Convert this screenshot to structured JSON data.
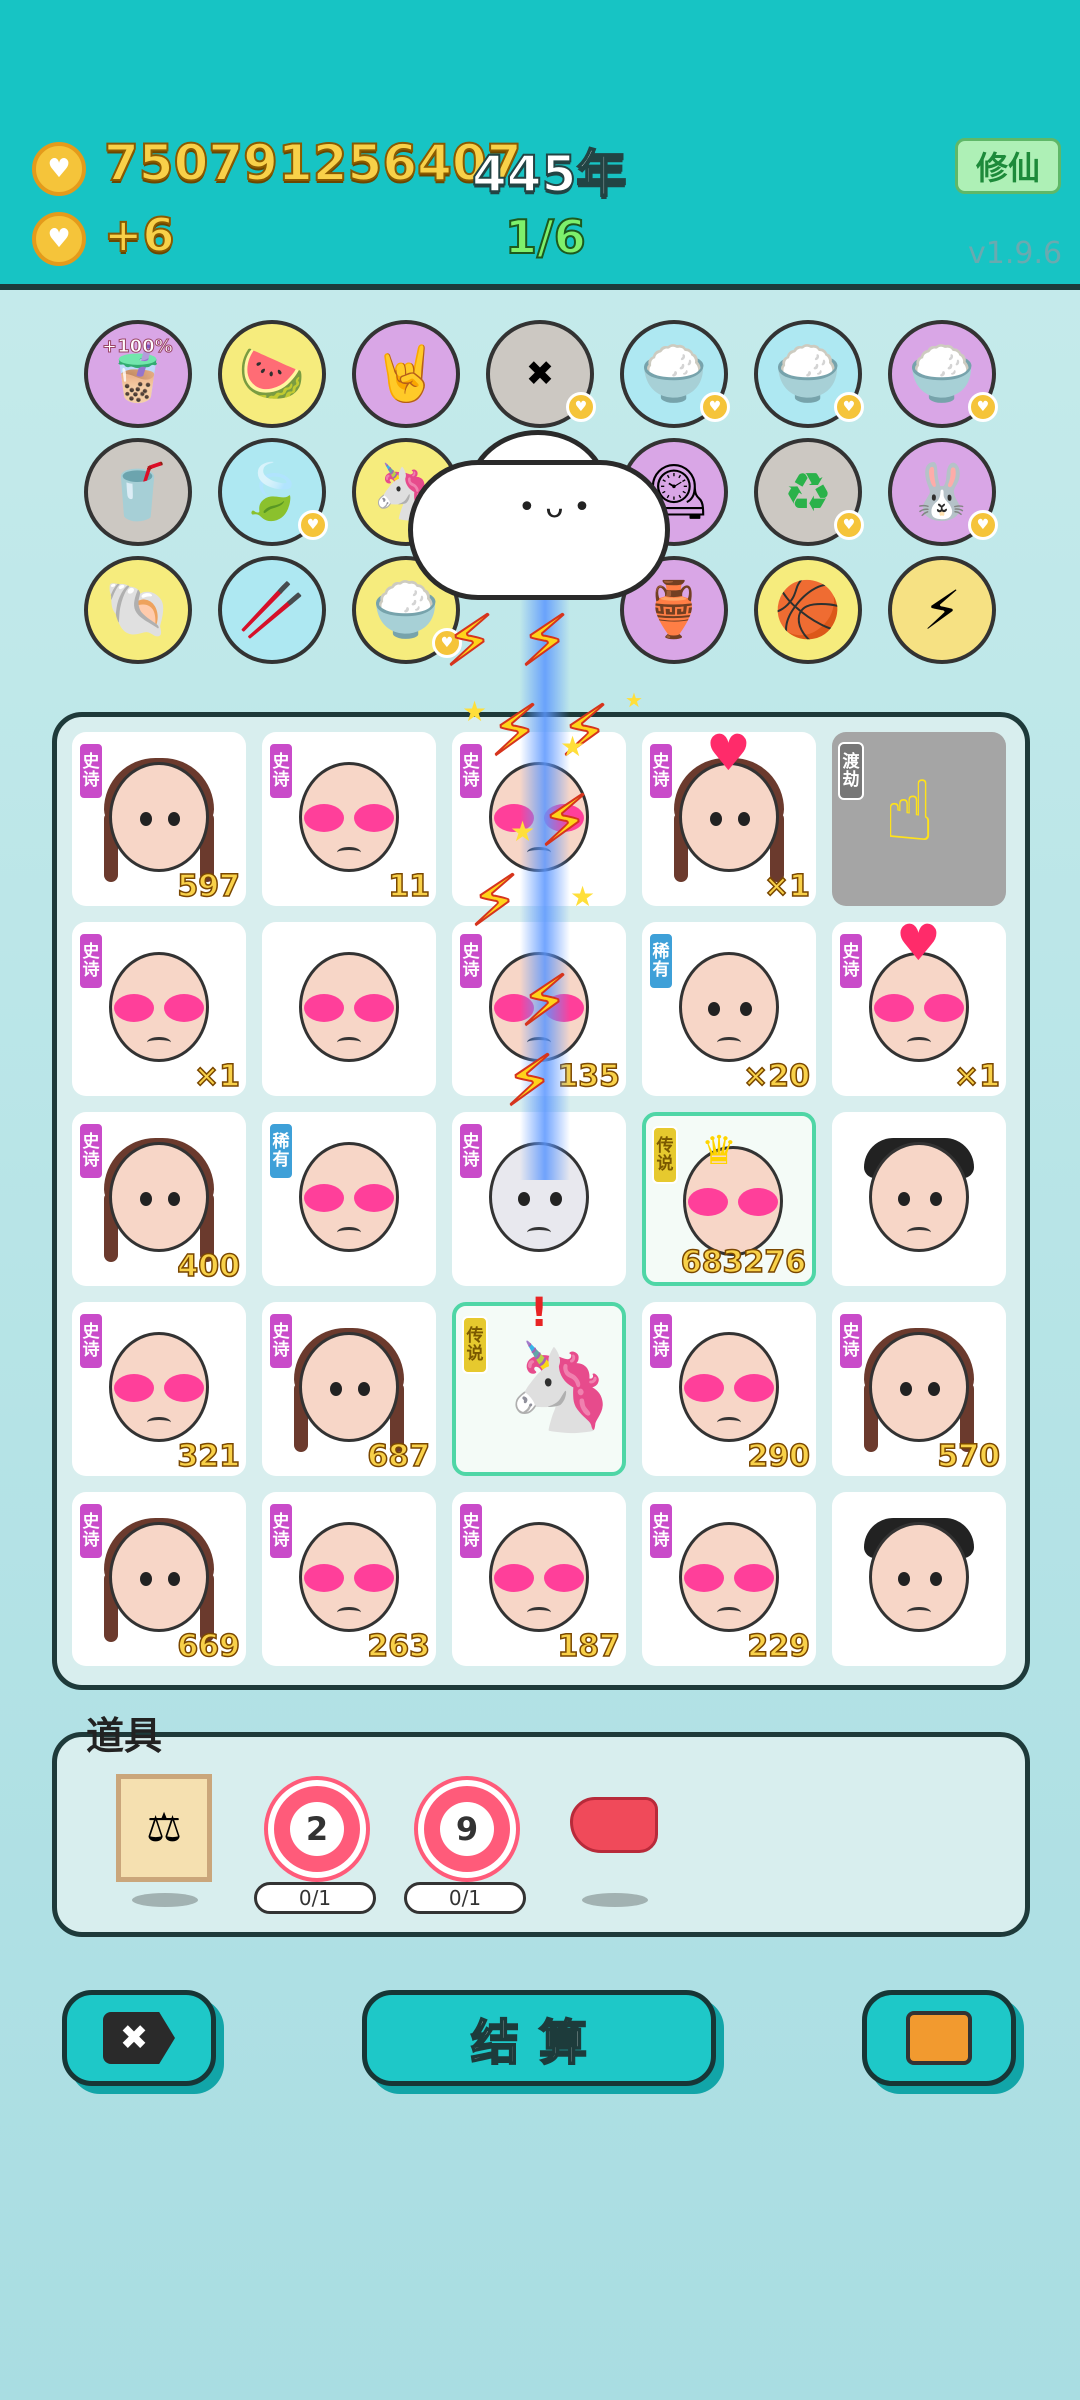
{
  "header": {
    "coins": "750791256407",
    "years": "445年",
    "income": "+6",
    "progress": "1/6",
    "xiuxian_label": "修仙",
    "version": "v1.9.6"
  },
  "items": {
    "row1": [
      {
        "icon": "milk-tea-icon",
        "glyph": "🧋",
        "tag": "+100%"
      },
      {
        "icon": "fruit-basket-icon",
        "glyph": "🍉",
        "tag": ""
      },
      {
        "icon": "rock-hand-icon",
        "glyph": "🤘",
        "tag": ""
      },
      {
        "icon": "delete-tag-icon",
        "glyph": "✖",
        "tag": ""
      },
      {
        "icon": "rice-bowl-icon",
        "glyph": "🍚",
        "tag": ""
      },
      {
        "icon": "rice-bowl-icon",
        "glyph": "🍚",
        "tag": ""
      },
      {
        "icon": "rice-bowl-icon",
        "glyph": "🍚",
        "tag": ""
      }
    ],
    "row2": [
      {
        "icon": "milk-tea-icon",
        "glyph": "🥤"
      },
      {
        "icon": "leaf-icon",
        "glyph": "🍃"
      },
      {
        "icon": "unicorn-icon",
        "glyph": "🦄"
      },
      {
        "icon": "time-portrait-icon",
        "glyph": "🕰"
      },
      {
        "icon": "refresh-icon",
        "glyph": "♻"
      },
      {
        "icon": "rabbit-icon",
        "glyph": "🐰"
      }
    ],
    "row3": [
      {
        "icon": "shell-icon",
        "glyph": "🐚"
      },
      {
        "icon": "chopsticks-icon",
        "glyph": "🥢"
      },
      {
        "icon": "rice-bowl-icon",
        "glyph": "🍚"
      },
      {
        "icon": "jar-icon",
        "glyph": "🏺"
      },
      {
        "icon": "basketballs-icon",
        "glyph": "🏀"
      },
      {
        "icon": "lightning-icon",
        "glyph": "⚡"
      }
    ]
  },
  "board": {
    "cells": [
      {
        "badge": "史诗",
        "kind": "epic",
        "face": "girl",
        "value": "597"
      },
      {
        "badge": "史诗",
        "kind": "epic",
        "face": "bald-heart",
        "value": "11"
      },
      {
        "badge": "史诗",
        "kind": "epic",
        "face": "bald-heart",
        "value": ""
      },
      {
        "badge": "史诗",
        "kind": "epic",
        "face": "girl",
        "value": "×1"
      },
      {
        "badge": "渡劫",
        "kind": "dujie",
        "face": "pointer",
        "value": ""
      },
      {
        "badge": "史诗",
        "kind": "epic",
        "face": "bald-heart",
        "value": "×1"
      },
      {
        "badge": "",
        "kind": "",
        "face": "old-heart",
        "value": ""
      },
      {
        "badge": "史诗",
        "kind": "epic",
        "face": "bald-heart",
        "value": "135"
      },
      {
        "badge": "稀有",
        "kind": "rare",
        "face": "bald-eyes",
        "value": "×20"
      },
      {
        "badge": "史诗",
        "kind": "epic",
        "face": "bald-heart",
        "value": "×1"
      },
      {
        "badge": "史诗",
        "kind": "epic",
        "face": "girl",
        "value": "400"
      },
      {
        "badge": "稀有",
        "kind": "rare",
        "face": "bald-heart",
        "value": ""
      },
      {
        "badge": "史诗",
        "kind": "epic",
        "face": "old-glasses",
        "value": ""
      },
      {
        "badge": "传说",
        "kind": "legend",
        "face": "king",
        "value": "683276"
      },
      {
        "badge": "",
        "kind": "",
        "face": "man",
        "value": ""
      },
      {
        "badge": "史诗",
        "kind": "epic",
        "face": "bald-heart",
        "value": "321"
      },
      {
        "badge": "史诗",
        "kind": "epic",
        "face": "girl",
        "value": "687"
      },
      {
        "badge": "传说",
        "kind": "legend",
        "face": "unicorn",
        "value": ""
      },
      {
        "badge": "史诗",
        "kind": "epic",
        "face": "bald-heart",
        "value": "290"
      },
      {
        "badge": "史诗",
        "kind": "epic",
        "face": "girl",
        "value": "570"
      },
      {
        "badge": "史诗",
        "kind": "epic",
        "face": "girl",
        "value": "669"
      },
      {
        "badge": "史诗",
        "kind": "epic",
        "face": "bald-heart",
        "value": "263"
      },
      {
        "badge": "史诗",
        "kind": "epic",
        "face": "bald-heart",
        "value": "187"
      },
      {
        "badge": "史诗",
        "kind": "epic",
        "face": "bald-heart",
        "value": "229"
      },
      {
        "badge": "",
        "kind": "",
        "face": "man",
        "value": ""
      }
    ]
  },
  "tools": {
    "title": "道具",
    "scale_icon": "scale-icon",
    "target1": {
      "number": "2",
      "count": "0/1"
    },
    "target2": {
      "number": "9",
      "count": "0/1"
    },
    "liver_icon": "liver-icon"
  },
  "bottom": {
    "settle_label": "结算",
    "delete_icon": "delete-tag-icon",
    "bag_icon": "briefcase-icon"
  },
  "colors": {
    "header": "#17c4c4",
    "gold": "#f8d149",
    "epic": "#c94bc9",
    "rare": "#3ea0d8",
    "legend": "#e6c92e"
  }
}
